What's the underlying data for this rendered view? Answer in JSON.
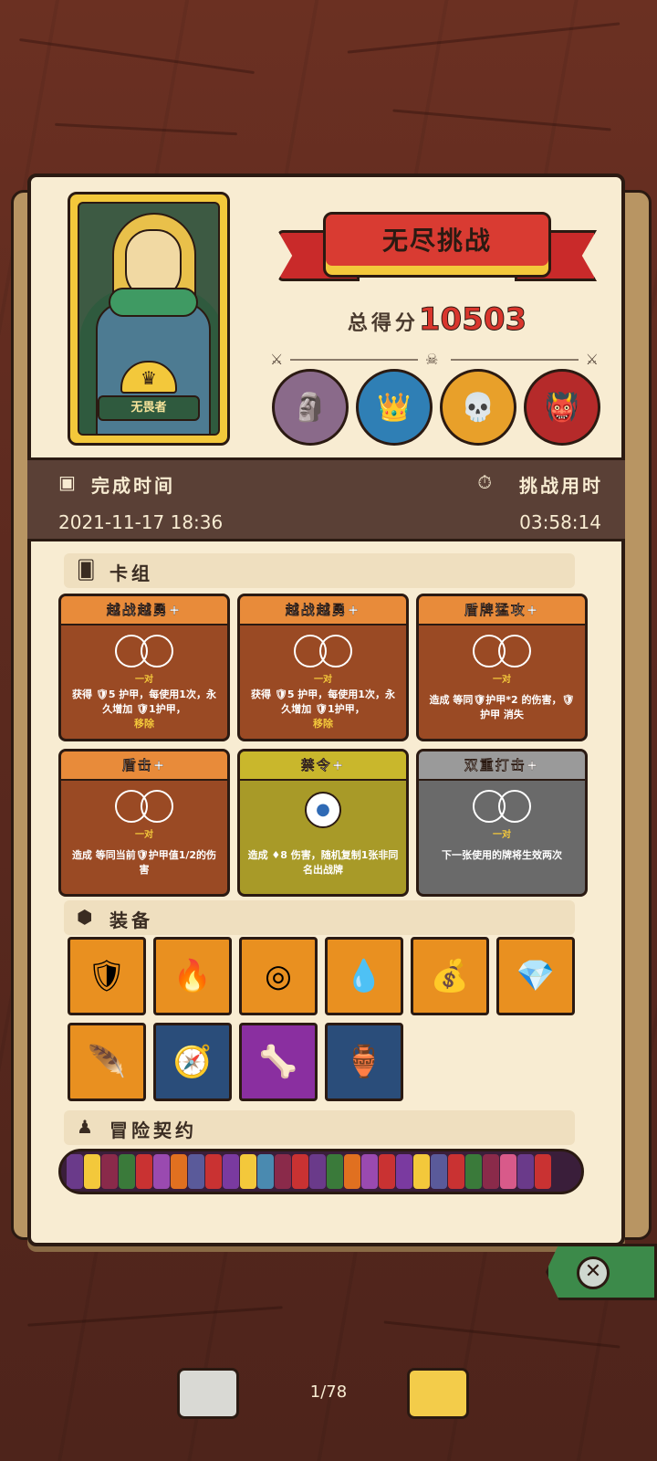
{
  "hero": {
    "name": "无畏者"
  },
  "banner": {
    "title": "无尽挑战"
  },
  "score": {
    "label": "总得分",
    "value": "10503"
  },
  "times": {
    "completion_label": "完成时间",
    "completion_value": "2021-11-17  18:36",
    "duration_label": "挑战用时",
    "duration_value": "03:58:14"
  },
  "sections": {
    "deck": "卡组",
    "equipment": "装备",
    "contracts": "冒险契约"
  },
  "cards": [
    {
      "title": "越战越勇+",
      "rarity": "一对",
      "desc": "获得 🛡5 护甲，每使用1次，永久增加 🛡1护甲，",
      "sub": "移除"
    },
    {
      "title": "越战越勇+",
      "rarity": "一对",
      "desc": "获得 🛡5 护甲，每使用1次，永久增加 🛡1护甲，",
      "sub": "移除"
    },
    {
      "title": "盾牌猛攻+",
      "rarity": "一对",
      "desc": "造成 等同🛡护甲*2 的伤害，🛡护甲 消失",
      "sub": ""
    },
    {
      "title": "盾击+",
      "rarity": "一对",
      "desc": "造成 等同当前🛡护甲值1/2的伤害",
      "sub": ""
    },
    {
      "title": "禁令+",
      "rarity": "",
      "desc": "造成 ♦8 伤害，随机复制1张非同名出战牌",
      "sub": ""
    },
    {
      "title": "双重打击+",
      "rarity": "一对",
      "desc": "下一张使用的牌将生效两次",
      "sub": ""
    }
  ],
  "pager": {
    "label": "1/78"
  },
  "colors": {
    "accent_red": "#d9362d",
    "parchment": "#f8ecd2",
    "wood": "#5a2a1e",
    "close_green": "#3c8a4a"
  }
}
